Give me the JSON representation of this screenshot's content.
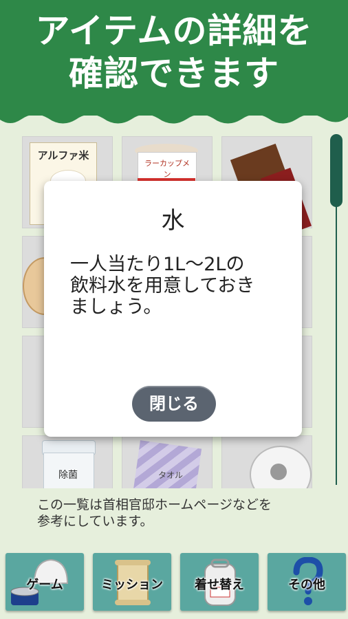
{
  "header": {
    "title_line1": "アイテムの詳細を",
    "title_line2": "確認できます"
  },
  "items": [
    {
      "name": "alpha-rice",
      "label": "アルファ米"
    },
    {
      "name": "cup-noodle",
      "label": "ラーカップメン"
    },
    {
      "name": "chocolate",
      "label": ""
    },
    {
      "name": "cracker",
      "label": ""
    },
    {
      "name": "blank-1",
      "label": ""
    },
    {
      "name": "blank-2",
      "label": ""
    },
    {
      "name": "blank-3",
      "label": ""
    },
    {
      "name": "blank-4",
      "label": ""
    },
    {
      "name": "blank-5",
      "label": ""
    },
    {
      "name": "wet-wipes",
      "label": "除菌"
    },
    {
      "name": "towel",
      "label": "タオル"
    },
    {
      "name": "toilet-paper",
      "label": ""
    }
  ],
  "dialog": {
    "title": "水",
    "body": "一人当たり1L～2Lの\n飲料水を用意しておき\nましょう。",
    "close_label": "閉じる"
  },
  "footnote": "この一覧は首相官邸ホームページなどを\n参考にしています。",
  "nav": [
    {
      "label": "ゲーム",
      "icon": "helmet-icon"
    },
    {
      "label": "ミッション",
      "icon": "scroll-icon"
    },
    {
      "label": "着せ替え",
      "icon": "backpack-icon"
    },
    {
      "label": "その他",
      "icon": "question-icon"
    }
  ],
  "colors": {
    "header": "#2e8848",
    "nav": "#5aa7a0",
    "button": "#5b6470",
    "scrollbar": "#1f5e4c"
  }
}
